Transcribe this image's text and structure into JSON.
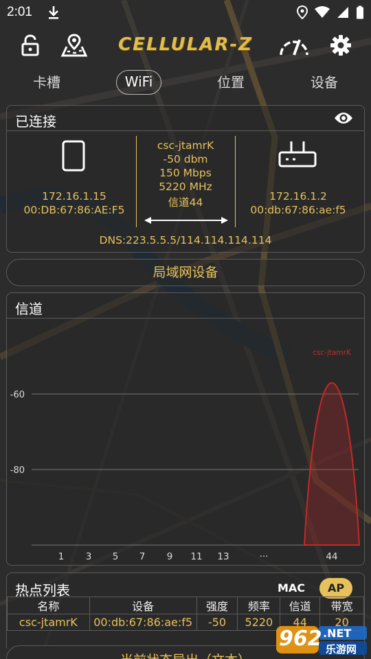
{
  "status_bar": {
    "time": "2:01"
  },
  "toolbar": {
    "logo": "CELLULAR-Z"
  },
  "tabs": [
    {
      "label": "卡槽",
      "active": false
    },
    {
      "label": "WiFi",
      "active": true
    },
    {
      "label": "位置",
      "active": false
    },
    {
      "label": "设备",
      "active": false
    }
  ],
  "connected": {
    "title": "已连接",
    "device_ip": "172.16.1.15",
    "device_mac": "00:DB:67:86:AE:F5",
    "ssid": "csc-jtamrK",
    "signal": "-50 dbm",
    "speed": "150 Mbps",
    "frequency": "5220 MHz",
    "channel": "信道44",
    "router_ip": "172.16.1.2",
    "router_mac": "00:db:67:86:ae:f5",
    "dns": "DNS:223.5.5.5/114.114.114.114"
  },
  "lan_button": "局域网设备",
  "channel_panel": {
    "title": "信道"
  },
  "chart_data": {
    "type": "area",
    "title": "信道",
    "y_ticks": [
      "-60",
      "-80"
    ],
    "y_tick_values": [
      -60,
      -80
    ],
    "x_ticks": [
      "1",
      "3",
      "5",
      "7",
      "9",
      "11",
      "13",
      "···",
      "44"
    ],
    "ylim": [
      -100,
      -40
    ],
    "series": [
      {
        "name": "csc-jtamrK",
        "channel": 44,
        "peak": -50,
        "color": "#c62828"
      }
    ]
  },
  "hotspot": {
    "title": "热点列表",
    "mac_toggle": "MAC",
    "ap_toggle": "AP",
    "columns": [
      "名称",
      "设备",
      "强度",
      "频率",
      "信道",
      "带宽"
    ],
    "rows": [
      [
        "csc-jtamrK",
        "00:db:67:86:ae:f5",
        "-50",
        "5220",
        "44",
        "20"
      ]
    ]
  },
  "bottom_bar_text": "当前状态导出（文本）",
  "watermark": {
    "number": "962",
    "suffix": ".NET",
    "site": "乐游网"
  },
  "colors": {
    "accent": "#e7c25b",
    "curve": "#c62828",
    "panel_border": "#5b5b5b"
  }
}
